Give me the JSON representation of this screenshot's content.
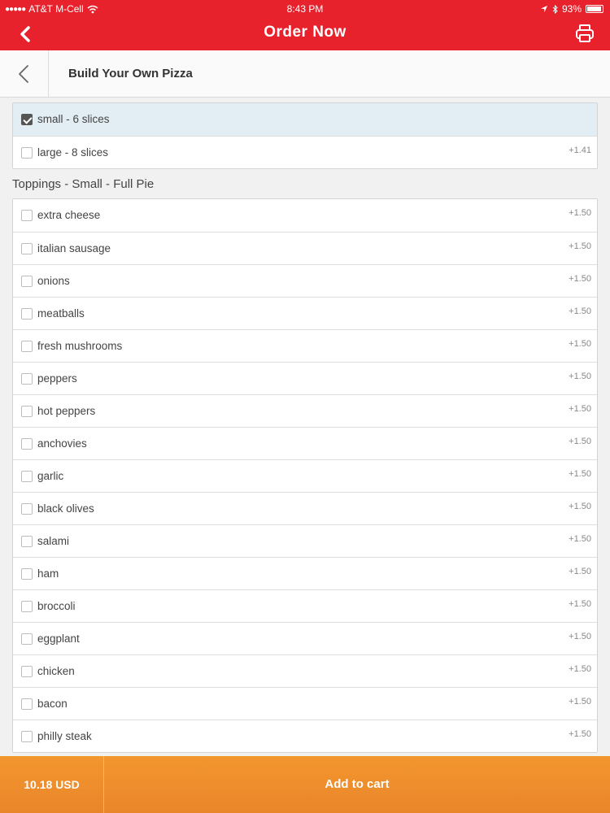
{
  "status_bar": {
    "carrier": "AT&T M-Cell",
    "time": "8:43 PM",
    "battery": "93%"
  },
  "navbar": {
    "title": "Order Now"
  },
  "subheader": {
    "title": "Build Your Own Pizza"
  },
  "sizes": [
    {
      "label": "small - 6 slices",
      "price": "",
      "checked": true
    },
    {
      "label": "large - 8 slices",
      "price": "+1.41",
      "checked": false
    }
  ],
  "toppings_title": "Toppings - Small - Full Pie",
  "toppings": [
    {
      "label": "extra cheese",
      "price": "+1.50"
    },
    {
      "label": "italian sausage",
      "price": "+1.50"
    },
    {
      "label": "onions",
      "price": "+1.50"
    },
    {
      "label": "meatballs",
      "price": "+1.50"
    },
    {
      "label": "fresh mushrooms",
      "price": "+1.50"
    },
    {
      "label": "peppers",
      "price": "+1.50"
    },
    {
      "label": "hot peppers",
      "price": "+1.50"
    },
    {
      "label": "anchovies",
      "price": "+1.50"
    },
    {
      "label": "garlic",
      "price": "+1.50"
    },
    {
      "label": "black olives",
      "price": "+1.50"
    },
    {
      "label": "salami",
      "price": "+1.50"
    },
    {
      "label": "ham",
      "price": "+1.50"
    },
    {
      "label": "broccoli",
      "price": "+1.50"
    },
    {
      "label": "eggplant",
      "price": "+1.50"
    },
    {
      "label": "chicken",
      "price": "+1.50"
    },
    {
      "label": "bacon",
      "price": "+1.50"
    },
    {
      "label": "philly steak",
      "price": "+1.50"
    }
  ],
  "footer": {
    "total": "10.18 USD",
    "add_to_cart": "Add to cart"
  },
  "colors": {
    "brand_red": "#e8222c",
    "footer_orange": "#f3962e",
    "selected_row": "#e3edf4"
  },
  "icons": {
    "nav_back": "chevron-left-icon",
    "print": "printer-icon",
    "sub_back": "chevron-left-icon",
    "wifi": "wifi-icon",
    "location": "location-arrow-icon",
    "bluetooth": "bluetooth-icon",
    "battery": "battery-icon"
  }
}
